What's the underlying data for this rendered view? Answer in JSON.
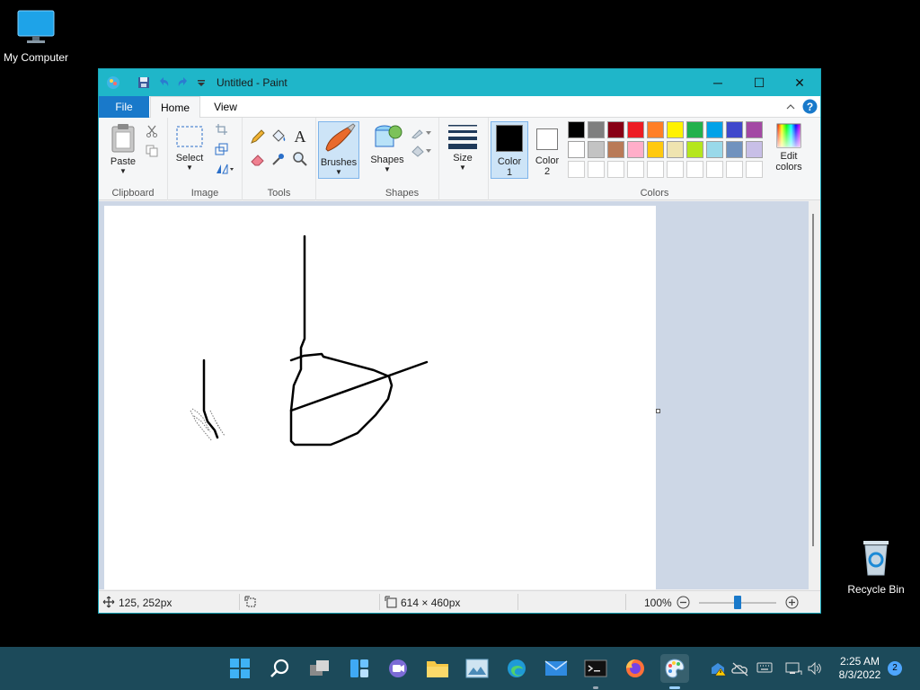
{
  "desktop": {
    "icons": [
      {
        "label": "My Computer",
        "icon": "monitor-icon"
      },
      {
        "label": "Recycle Bin",
        "icon": "recycle-bin-icon"
      }
    ]
  },
  "window": {
    "title": "Untitled - Paint",
    "controls": {
      "minimize": "─",
      "maximize": "☐",
      "close": "✕"
    }
  },
  "tabs": [
    {
      "label": "File"
    },
    {
      "label": "Home"
    },
    {
      "label": "View"
    }
  ],
  "ribbon": {
    "groups": {
      "clipboard": {
        "label": "Clipboard",
        "paste": "Paste"
      },
      "image": {
        "label": "Image",
        "select": "Select"
      },
      "tools": {
        "label": "Tools"
      },
      "brushes": {
        "label": "Brushes"
      },
      "shapes": {
        "label": "Shapes",
        "shapes_button": "Shapes"
      },
      "size": {
        "label": "Size"
      },
      "colors": {
        "label": "Colors",
        "color1_line1": "Color",
        "color1_line2": "1",
        "color2_line1": "Color",
        "color2_line2": "2",
        "edit_line1": "Edit",
        "edit_line2": "colors",
        "color1_value": "#000000",
        "color2_value": "#ffffff",
        "palette_row1": [
          "#000000",
          "#7f7f7f",
          "#880015",
          "#ed1c24",
          "#ff7f27",
          "#fff200",
          "#22b14c",
          "#00a2e8",
          "#3f48cc",
          "#a349a4"
        ],
        "palette_row2": [
          "#ffffff",
          "#c3c3c3",
          "#b97a57",
          "#ffaec9",
          "#ffc90e",
          "#efe4b0",
          "#b5e61d",
          "#99d9ea",
          "#7092be",
          "#c8bfe7"
        ]
      }
    }
  },
  "status": {
    "cursor_pos": "125, 252px",
    "canvas_size": "614 × 460px",
    "zoom": "100%",
    "zoom_fraction": 0.5
  },
  "taskbar": {
    "time": "2:25 AM",
    "date": "8/3/2022",
    "notifications": "2",
    "apps": [
      "start-icon",
      "search-icon",
      "task-view-icon",
      "widgets-icon",
      "chat-icon",
      "file-explorer-icon",
      "photos-icon",
      "edge-icon",
      "mail-icon",
      "terminal-icon",
      "firefox-icon",
      "paint-icon"
    ]
  }
}
